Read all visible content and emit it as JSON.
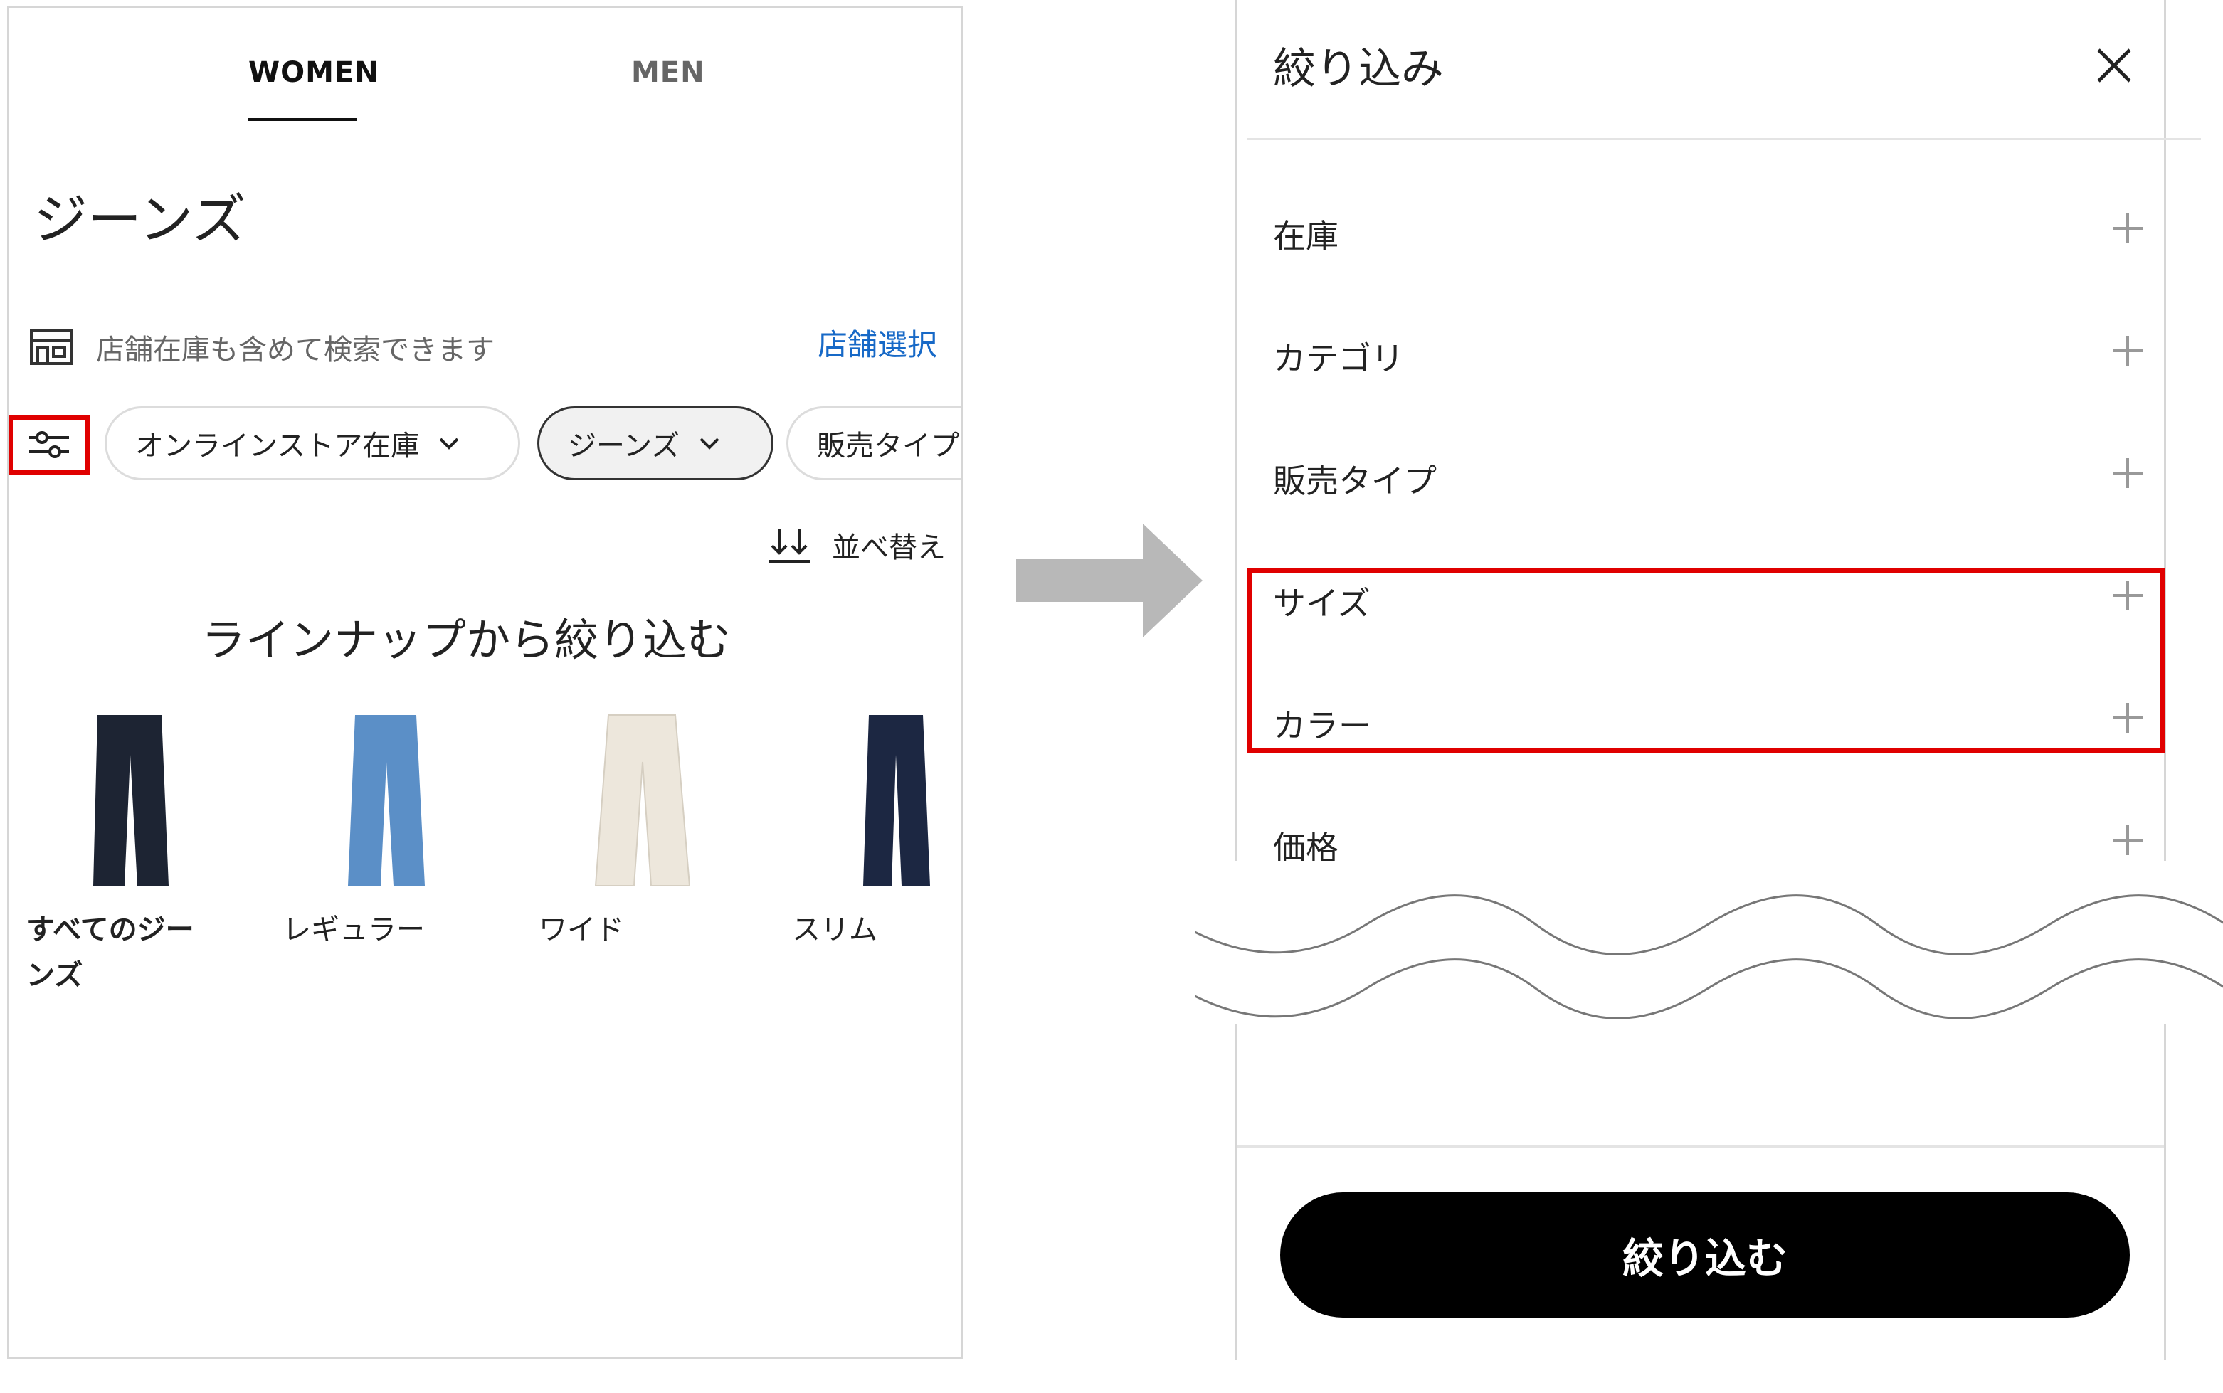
{
  "left_screen": {
    "tabs": [
      {
        "label": "WOMEN",
        "active": true
      },
      {
        "label": "MEN",
        "active": false
      }
    ],
    "page_title": "ジーンズ",
    "store_notice": "店舗在庫も含めて検索できます",
    "store_select": "店舗選択",
    "filter_chips": [
      "オンラインストア在庫",
      "ジーンズ",
      "販売タイプ"
    ],
    "sort_label": "並べ替え",
    "lineup_heading": "ラインナップから絞り込む",
    "products": [
      {
        "label": "すべてのジーンズ",
        "color": "#1d2433"
      },
      {
        "label": "レギュラー",
        "color": "#5b8fc7"
      },
      {
        "label": "ワイド",
        "color": "#ede7dc"
      },
      {
        "label": "スリム",
        "color": "#1c2742"
      }
    ]
  },
  "right_screen": {
    "title": "絞り込み",
    "facets": [
      "在庫",
      "カテゴリ",
      "販売タイプ",
      "サイズ",
      "カラー",
      "価格"
    ],
    "apply_button": "絞り込む"
  },
  "colors": {
    "highlight": "#e00000",
    "link": "#1769c7",
    "arrow": "#b8b8b8"
  }
}
